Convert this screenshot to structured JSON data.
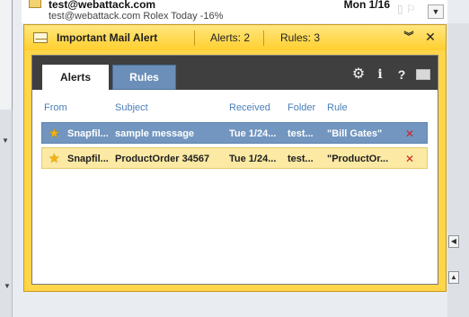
{
  "background": {
    "sender": "test@webattack.com",
    "date": "Mon 1/16",
    "preview": "test@webattack.com Rolex Today -16%"
  },
  "alert_window": {
    "title": "Important Mail Alert",
    "alerts_count": "Alerts: 2",
    "rules_count": "Rules: 3",
    "tabs": [
      {
        "label": "Alerts",
        "active": true
      },
      {
        "label": "Rules",
        "active": false
      }
    ],
    "toolbar_icons": [
      "gear-icon",
      "info-icon",
      "help-icon",
      "mail-icon"
    ],
    "columns": [
      "From",
      "Subject",
      "Received",
      "Folder",
      "Rule"
    ],
    "rows": [
      {
        "from": "Snapfil...",
        "subject": "sample message",
        "received": "Tue 1/24...",
        "folder": "test...",
        "rule": "\"Bill Gates\"",
        "selected": true
      },
      {
        "from": "Snapfil...",
        "subject": "ProductOrder 34567",
        "received": "Tue 1/24...",
        "folder": "test...",
        "rule": "\"ProductOr...",
        "selected": false
      }
    ]
  }
}
